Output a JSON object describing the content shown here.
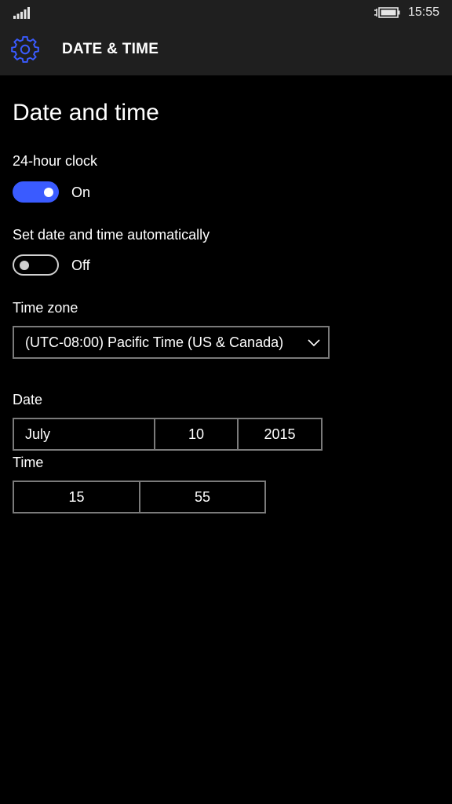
{
  "status_bar": {
    "signal_icon": "signal-strength-icon",
    "battery_icon": "battery-charging-icon",
    "time": "15:55"
  },
  "header": {
    "icon": "gear-icon",
    "title": "DATE & TIME"
  },
  "page": {
    "title": "Date and time"
  },
  "clock_24h": {
    "label": "24-hour clock",
    "state": "On",
    "enabled": true
  },
  "auto_time": {
    "label": "Set date and time automatically",
    "state": "Off",
    "enabled": false
  },
  "timezone": {
    "label": "Time zone",
    "value": "(UTC-08:00) Pacific Time (US & Canada)",
    "icon": "chevron-down-icon"
  },
  "date": {
    "label": "Date",
    "month": "July",
    "day": "10",
    "year": "2015"
  },
  "time": {
    "label": "Time",
    "hour": "15",
    "minute": "55"
  },
  "colors": {
    "accent": "#3a5bff",
    "chrome": "#1f1f1f",
    "background": "#000000",
    "border": "#7a7a7a"
  }
}
